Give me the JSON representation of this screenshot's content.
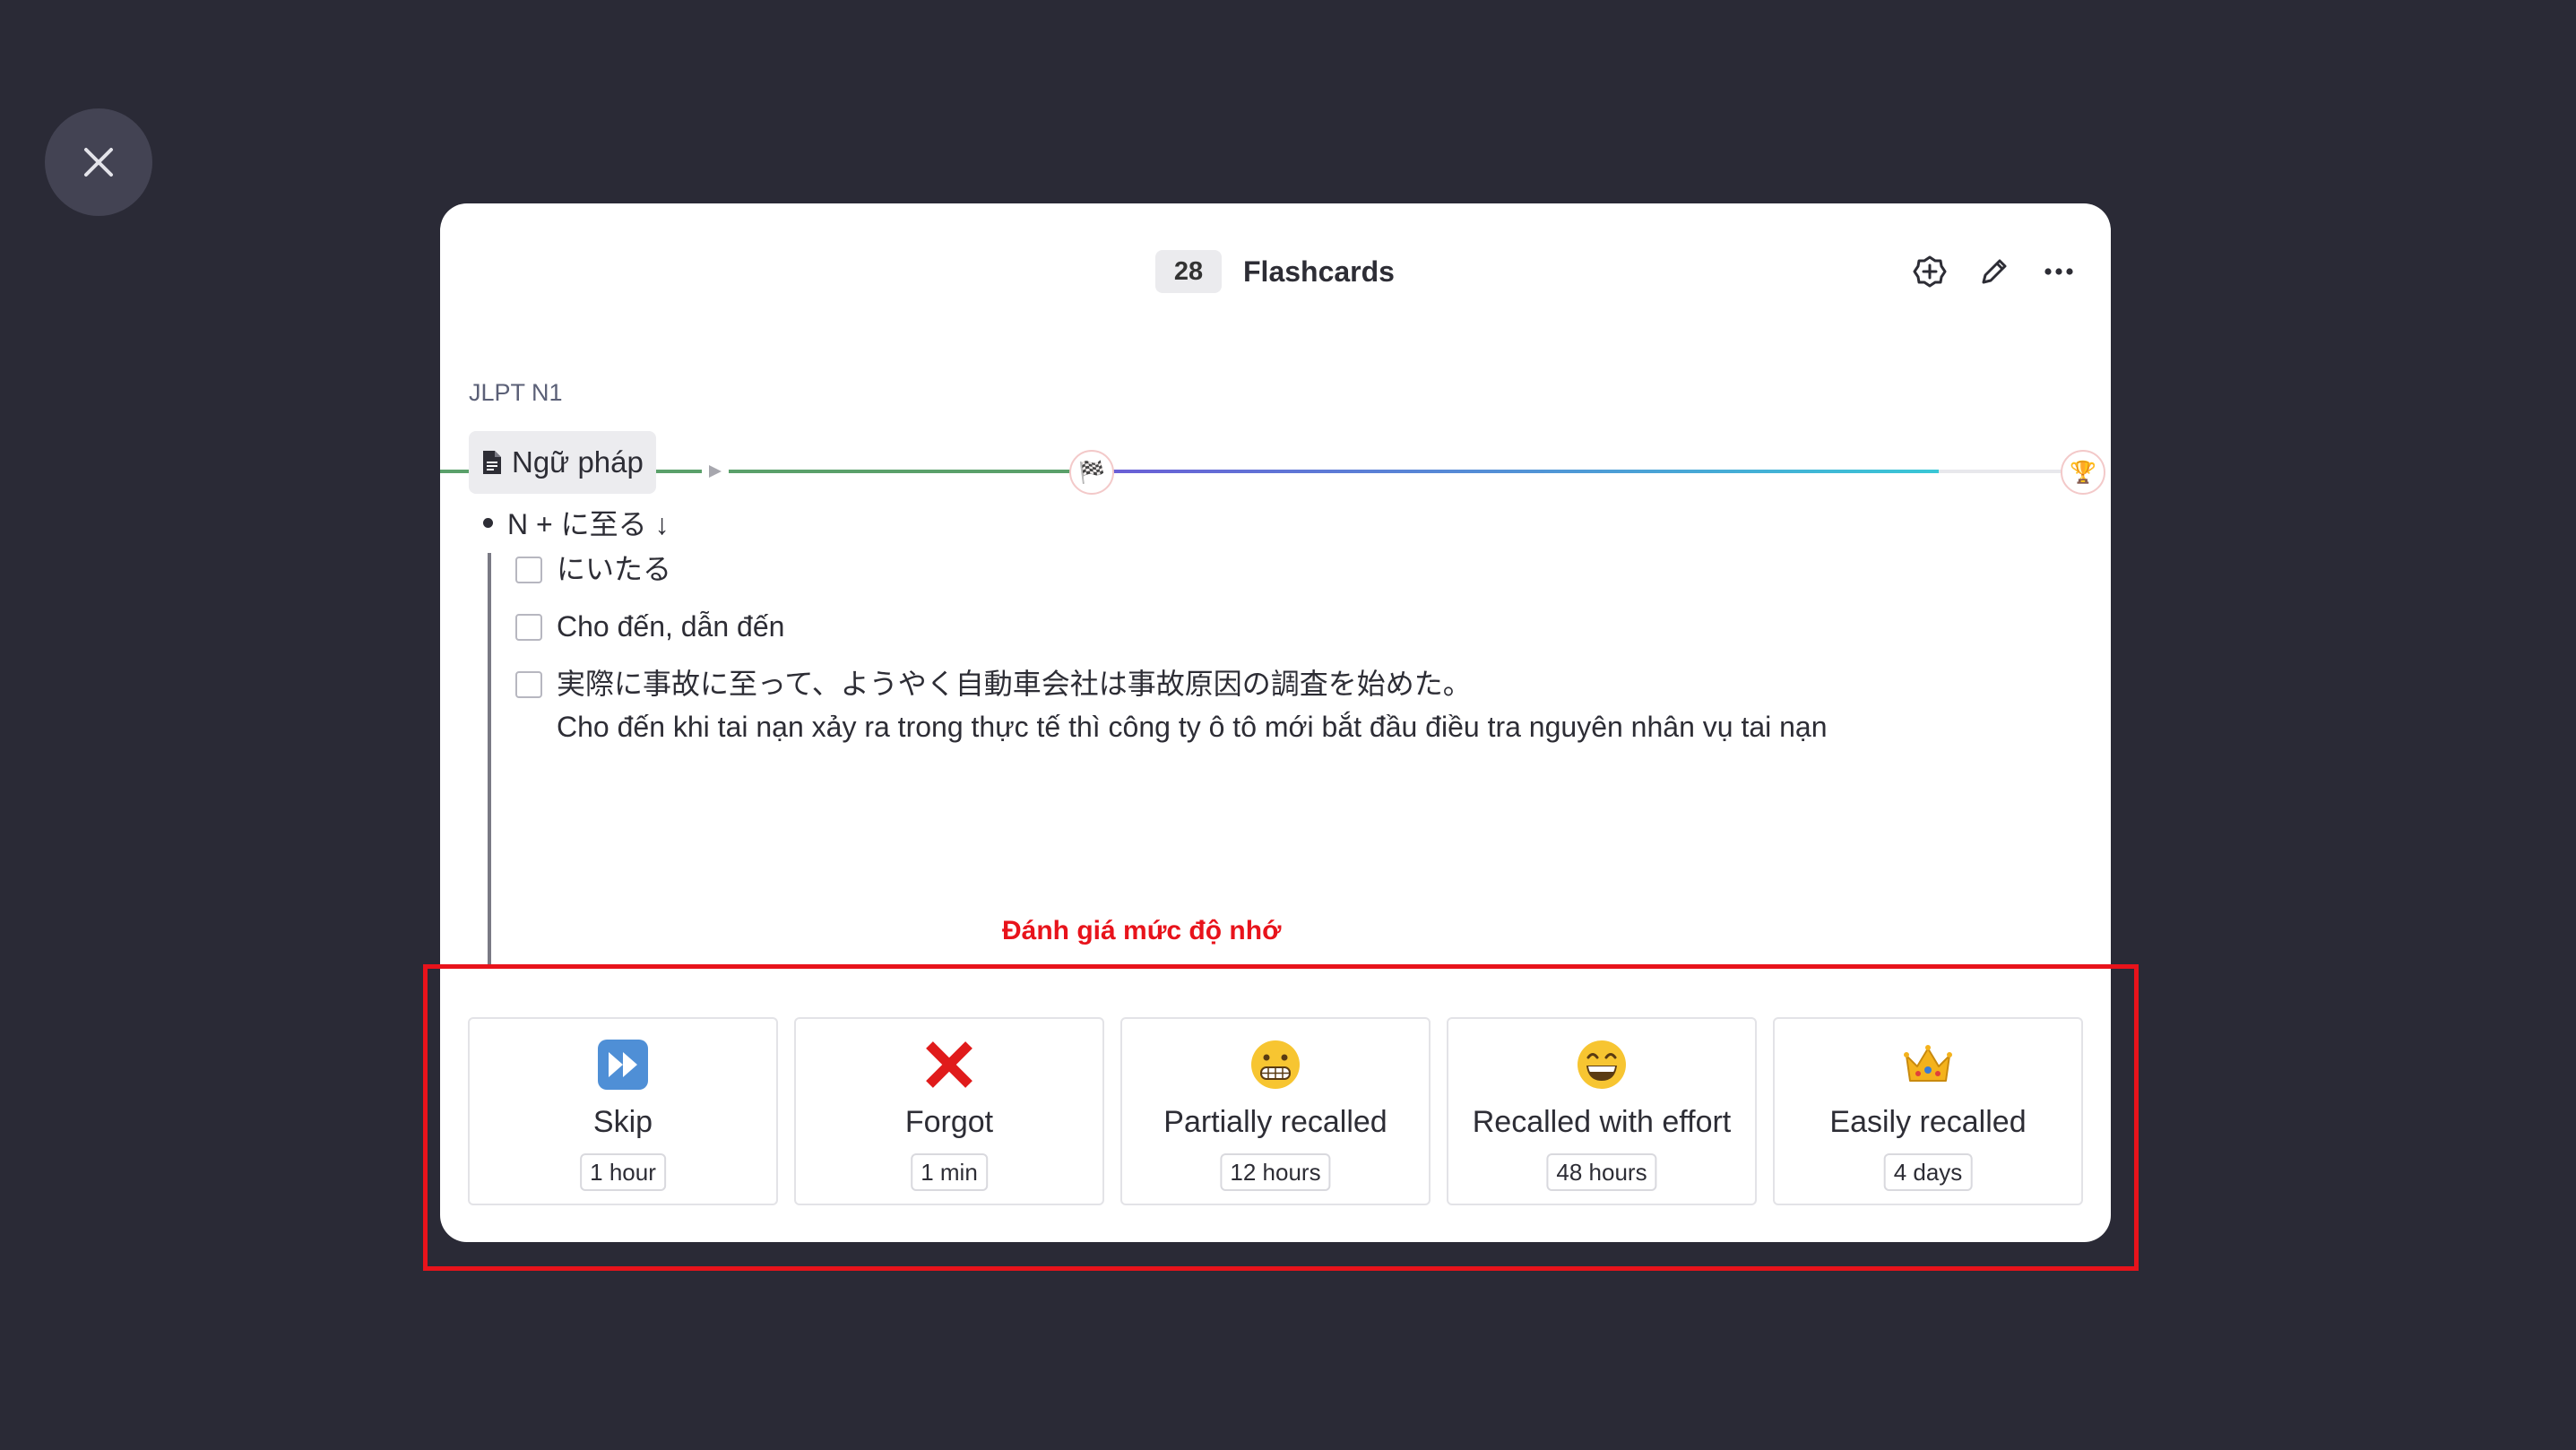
{
  "header": {
    "count": "28",
    "title": "Flashcards"
  },
  "icons": {
    "close": "close-icon",
    "add": "add-card-icon",
    "edit": "pencil-icon",
    "more": "more-horizontal-icon",
    "milestone_start": "checkered-flag-icon",
    "milestone_end": "trophy-icon"
  },
  "progress": {
    "milestone_glyph": "🏁",
    "trophy_glyph": "🏆"
  },
  "card": {
    "breadcrumb": "JLPT N1",
    "page_title": "Ngữ pháp",
    "bullet": "N + に至る ↓",
    "items": [
      "にいたる",
      "Cho đến, dẫn đến",
      "実際に事故に至って、ようやく自動車会社は事故原因の調査を始めた。",
      "Cho đến khi tai nạn xảy ra trong thực tế thì công ty ô tô mới bắt đầu điều tra nguyên nhân vụ tai nạn"
    ]
  },
  "annotation": "Đánh giá mức độ nhớ",
  "ratings": [
    {
      "emoji": "⏩",
      "label": "Skip",
      "interval": "1 hour"
    },
    {
      "emoji": "❌",
      "label": "Forgot",
      "interval": "1 min"
    },
    {
      "emoji": "😬",
      "label": "Partially recalled",
      "interval": "12 hours"
    },
    {
      "emoji": "😄",
      "label": "Recalled with effort",
      "interval": "48 hours"
    },
    {
      "emoji": "👑",
      "label": "Easily recalled",
      "interval": "4 days"
    }
  ],
  "colors": {
    "background": "#2a2a36",
    "progress_done": "#5aa06a",
    "progress_gradient_start": "#6a5fd6",
    "progress_gradient_end": "#39c7d6",
    "annotation": "#e8131b"
  }
}
